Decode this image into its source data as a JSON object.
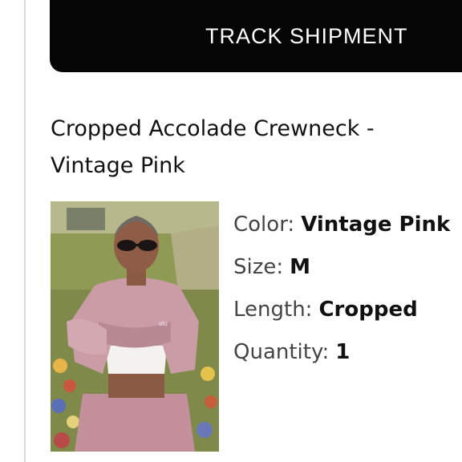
{
  "header": {
    "track_button_label": "TRACK SHIPMENT"
  },
  "product": {
    "title": "Cropped Accolade Crewneck - Vintage Pink",
    "image_alt": "model wearing a pink cropped crewneck sweatshirt",
    "brand_mark": "alo",
    "specs": [
      {
        "label": "Color:",
        "value": "Vintage Pink"
      },
      {
        "label": "Size:",
        "value": "M"
      },
      {
        "label": "Length:",
        "value": "Cropped"
      },
      {
        "label": "Quantity:",
        "value": "1"
      }
    ]
  },
  "colors": {
    "button_bg": "#050505",
    "button_text": "#ffffff",
    "sweater_pink": "#c99ca6"
  }
}
